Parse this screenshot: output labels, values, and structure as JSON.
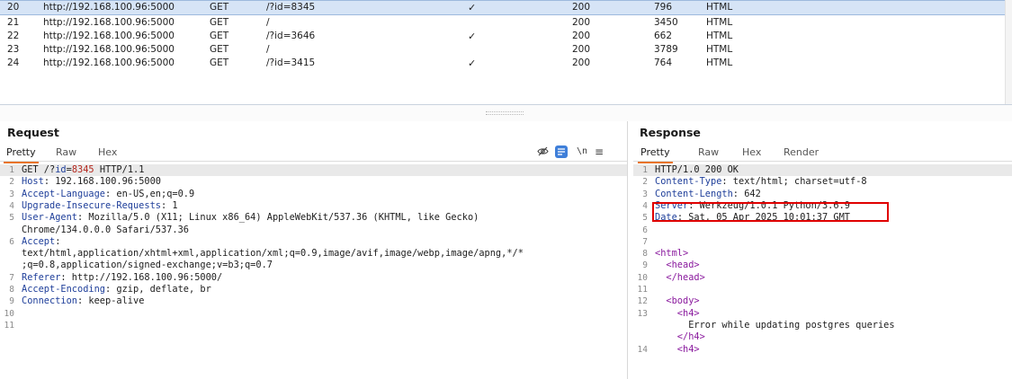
{
  "history": {
    "rows": [
      {
        "num": "20",
        "host": "http://192.168.100.96:5000",
        "method": "GET",
        "url": "/?id=8345",
        "params": "✓",
        "status": "200",
        "length": "796",
        "mime": "HTML",
        "selected": true
      },
      {
        "num": "21",
        "host": "http://192.168.100.96:5000",
        "method": "GET",
        "url": "/",
        "params": "",
        "status": "200",
        "length": "3450",
        "mime": "HTML"
      },
      {
        "num": "22",
        "host": "http://192.168.100.96:5000",
        "method": "GET",
        "url": "/?id=3646",
        "params": "✓",
        "status": "200",
        "length": "662",
        "mime": "HTML"
      },
      {
        "num": "23",
        "host": "http://192.168.100.96:5000",
        "method": "GET",
        "url": "/",
        "params": "",
        "status": "200",
        "length": "3789",
        "mime": "HTML"
      },
      {
        "num": "24",
        "host": "http://192.168.100.96:5000",
        "method": "GET",
        "url": "/?id=3415",
        "params": "✓",
        "status": "200",
        "length": "764",
        "mime": "HTML"
      }
    ]
  },
  "request": {
    "title": "Request",
    "tabs": [
      "Pretty",
      "Raw",
      "Hex"
    ],
    "active_tab": "Pretty",
    "toolbar_icons": [
      "eye-slash-icon",
      "line-wrap-icon",
      "newline-icon",
      "menu-icon"
    ],
    "toolbar_glyphs": {
      "newline": "\\n",
      "menu": "≡"
    },
    "lines": [
      {
        "n": "1",
        "parts": [
          {
            "t": "GET /?",
            "c": "val"
          },
          {
            "t": "id",
            "c": "hdr"
          },
          {
            "t": "=",
            "c": "val"
          },
          {
            "t": "8345",
            "c": "param"
          },
          {
            "t": " HTTP/1.1",
            "c": "val"
          }
        ],
        "hl": true
      },
      {
        "n": "2",
        "parts": [
          {
            "t": "Host",
            "c": "hdr"
          },
          {
            "t": ": 192.168.100.96:5000",
            "c": "val"
          }
        ]
      },
      {
        "n": "3",
        "parts": [
          {
            "t": "Accept-Language",
            "c": "hdr"
          },
          {
            "t": ": en-US,en;q=0.9",
            "c": "val"
          }
        ]
      },
      {
        "n": "4",
        "parts": [
          {
            "t": "Upgrade-Insecure-Requests",
            "c": "hdr"
          },
          {
            "t": ": 1",
            "c": "val"
          }
        ]
      },
      {
        "n": "5",
        "parts": [
          {
            "t": "User-Agent",
            "c": "hdr"
          },
          {
            "t": ": Mozilla/5.0 (X11; Linux x86_64) AppleWebKit/537.36 (KHTML, like Gecko)",
            "c": "val"
          }
        ]
      },
      {
        "n": "",
        "parts": [
          {
            "t": "Chrome/134.0.0.0 Safari/537.36",
            "c": "val"
          }
        ]
      },
      {
        "n": "6",
        "parts": [
          {
            "t": "Accept",
            "c": "hdr"
          },
          {
            "t": ":",
            "c": "val"
          }
        ]
      },
      {
        "n": "",
        "parts": [
          {
            "t": "text/html,application/xhtml+xml,application/xml;q=0.9,image/avif,image/webp,image/apng,*/*",
            "c": "val"
          }
        ]
      },
      {
        "n": "",
        "parts": [
          {
            "t": ";q=0.8,application/signed-exchange;v=b3;q=0.7",
            "c": "val"
          }
        ]
      },
      {
        "n": "7",
        "parts": [
          {
            "t": "Referer",
            "c": "hdr"
          },
          {
            "t": ": http://192.168.100.96:5000/",
            "c": "val"
          }
        ]
      },
      {
        "n": "8",
        "parts": [
          {
            "t": "Accept-Encoding",
            "c": "hdr"
          },
          {
            "t": ": gzip, deflate, br",
            "c": "val"
          }
        ]
      },
      {
        "n": "9",
        "parts": [
          {
            "t": "Connection",
            "c": "hdr"
          },
          {
            "t": ": keep-alive",
            "c": "val"
          }
        ]
      },
      {
        "n": "10",
        "parts": []
      },
      {
        "n": "11",
        "parts": []
      }
    ]
  },
  "response": {
    "title": "Response",
    "tabs": [
      "Pretty",
      "Raw",
      "Hex",
      "Render"
    ],
    "active_tab": "Pretty",
    "lines": [
      {
        "n": "1",
        "parts": [
          {
            "t": "HTTP/1.0 200 OK",
            "c": "val"
          }
        ],
        "hl": true
      },
      {
        "n": "2",
        "parts": [
          {
            "t": "Content-Type",
            "c": "hdr"
          },
          {
            "t": ": text/html; charset=utf-8",
            "c": "val"
          }
        ]
      },
      {
        "n": "3",
        "parts": [
          {
            "t": "Content-Length",
            "c": "hdr"
          },
          {
            "t": ": 642",
            "c": "val"
          }
        ]
      },
      {
        "n": "4",
        "parts": [
          {
            "t": "Server",
            "c": "hdr"
          },
          {
            "t": ": Werkzeug/1.0.1 Python/3.6.9",
            "c": "val"
          }
        ]
      },
      {
        "n": "5",
        "parts": [
          {
            "t": "Date",
            "c": "hdr"
          },
          {
            "t": ": Sat, 05 Apr 2025 10:01:37 GMT",
            "c": "val"
          }
        ]
      },
      {
        "n": "6",
        "parts": []
      },
      {
        "n": "7",
        "parts": []
      },
      {
        "n": "8",
        "parts": [
          {
            "t": "<html>",
            "c": "tag"
          }
        ]
      },
      {
        "n": "9",
        "parts": [
          {
            "t": "  <head>",
            "c": "tag"
          }
        ]
      },
      {
        "n": "10",
        "parts": [
          {
            "t": "  </head>",
            "c": "tag"
          }
        ]
      },
      {
        "n": "11",
        "parts": []
      },
      {
        "n": "12",
        "parts": [
          {
            "t": "  <body>",
            "c": "tag"
          }
        ]
      },
      {
        "n": "13",
        "parts": [
          {
            "t": "    <h4>",
            "c": "tag"
          }
        ]
      },
      {
        "n": "",
        "parts": [
          {
            "t": "      Error while updating postgres queries",
            "c": "val"
          }
        ]
      },
      {
        "n": "",
        "parts": [
          {
            "t": "    </h4>",
            "c": "tag"
          }
        ]
      },
      {
        "n": "14",
        "parts": [
          {
            "t": "    <h4>",
            "c": "tag"
          }
        ]
      }
    ],
    "highlight_box_color": "#e00000"
  },
  "colors": {
    "accent_tab": "#e8742a",
    "selected_row": "#d6e4f6",
    "header_name": "#1f3f9a",
    "param_value": "#b4271d",
    "html_tag": "#8a1a9e"
  }
}
